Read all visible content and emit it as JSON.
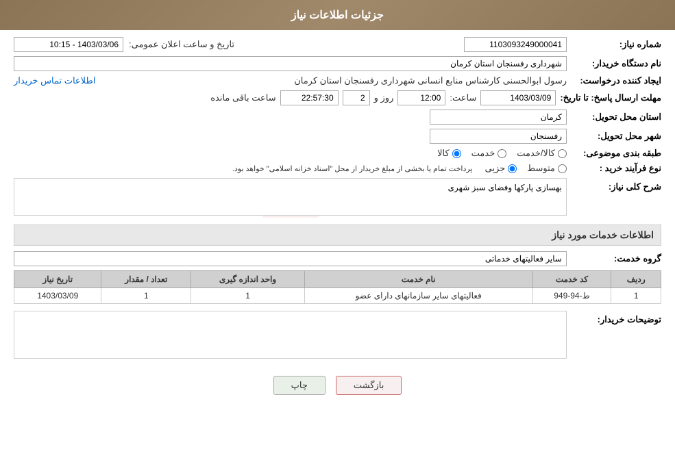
{
  "header": {
    "title": "جزئیات اطلاعات نیاز"
  },
  "form": {
    "need_number_label": "شماره نیاز:",
    "need_number_value": "1103093249000041",
    "buyer_label": "نام دستگاه خریدار:",
    "buyer_value": "شهرداری رفسنجان استان کرمان",
    "announce_label": "تاریخ و ساعت اعلان عمومی:",
    "announce_value": "1403/03/06 - 10:15",
    "creator_label": "ایجاد کننده درخواست:",
    "creator_value": "رسول ابوالحسنی کارشناس منابع انسانی شهرداری رفسنجان استان کرمان",
    "creator_link": "اطلاعات تماس خریدار",
    "reply_deadline_label": "مهلت ارسال پاسخ: تا تاریخ:",
    "reply_date": "1403/03/09",
    "reply_time_label": "ساعت:",
    "reply_time": "12:00",
    "reply_days_label": "روز و",
    "reply_days": "2",
    "reply_remaining_label": "ساعت باقی مانده",
    "reply_remaining": "22:57:30",
    "province_label": "استان محل تحویل:",
    "province_value": "کرمان",
    "city_label": "شهر محل تحویل:",
    "city_value": "رفسنجان",
    "category_label": "طبقه بندی موضوعی:",
    "category_kala": "کالا",
    "category_khedmat": "خدمت",
    "category_kala_khedmat": "کالا/خدمت",
    "purchase_type_label": "نوع فرآیند خرید :",
    "purchase_jozii": "جزیی",
    "purchase_motavaset": "متوسط",
    "purchase_note": "پرداخت تمام یا بخشی از مبلغ خریدار از محل \"اسناد خزانه اسلامی\" خواهد بود.",
    "description_label": "شرح کلی نیاز:",
    "description_value": "بهسازی پارکها وفضای سبز شهری",
    "services_section_title": "اطلاعات خدمات مورد نیاز",
    "service_group_label": "گروه خدمت:",
    "service_group_value": "سایر فعالیتهای خدماتی",
    "table": {
      "headers": [
        "ردیف",
        "کد خدمت",
        "نام خدمت",
        "واحد اندازه گیری",
        "تعداد / مقدار",
        "تاریخ نیاز"
      ],
      "rows": [
        {
          "row": "1",
          "code": "ط-94-949",
          "name": "فعالیتهای سایر سازمانهای دارای عضو",
          "unit": "1",
          "qty": "1",
          "date": "1403/03/09"
        }
      ]
    },
    "buyer_notes_label": "توضیحات خریدار:",
    "buyer_notes_value": "",
    "btn_print": "چاپ",
    "btn_back": "بازگشت"
  }
}
